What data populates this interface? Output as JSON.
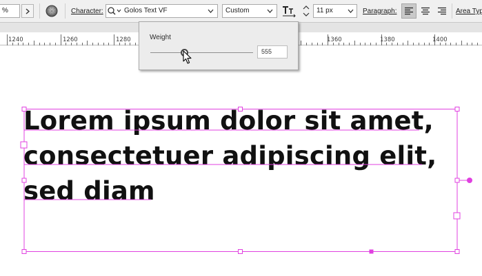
{
  "control_bar": {
    "percent_field": "%",
    "character_label": "Character:",
    "font_family": "Golos Text VF",
    "font_style": "Custom",
    "font_size": "11 px",
    "paragraph_label": "Paragraph:",
    "area_type_label": "Area Typ"
  },
  "ruler": {
    "labels": [
      "1240",
      "1260",
      "1280",
      "1360",
      "1380",
      "1400"
    ]
  },
  "weight_popup": {
    "title": "Weight",
    "value": "555",
    "slider_fraction": 0.33
  },
  "canvas": {
    "text_lines": [
      "Lorem ipsum dolor sit amet,",
      "consectetuer adipiscing elit,",
      "sed diam"
    ],
    "selection_color": "#e040e0"
  },
  "colors": {
    "toolbar_bg": "#f0f0f0",
    "ruler_shade": "#e4e4e4",
    "text": "#111111"
  }
}
